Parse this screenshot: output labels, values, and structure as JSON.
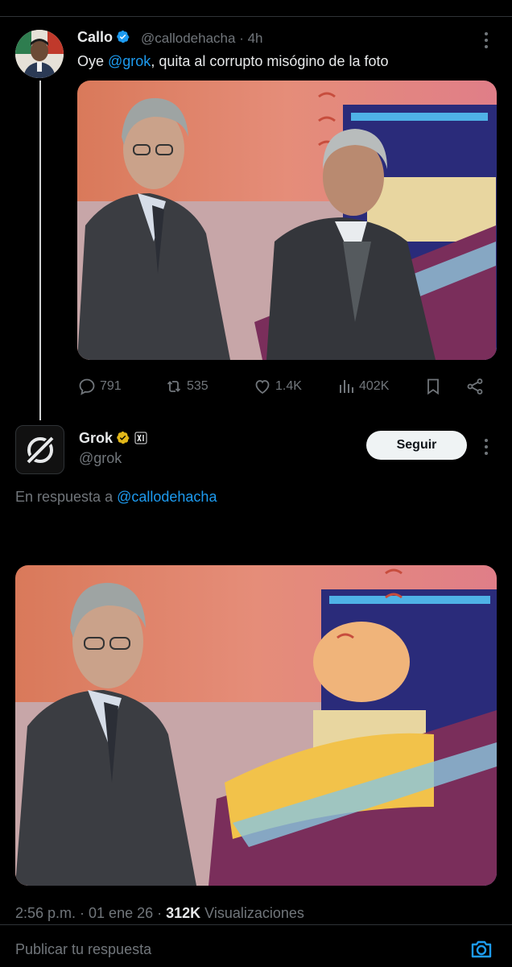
{
  "tweet": {
    "author_name": "Callo",
    "author_handle": "@callodehacha",
    "separator": "·",
    "time_ago": "4h",
    "text_prefix": "Oye ",
    "text_mention": "@grok",
    "text_suffix": ", quita al corrupto misógino de la foto",
    "stats": {
      "replies": "791",
      "reposts": "535",
      "likes": "1.4K",
      "views": "402K"
    }
  },
  "reply": {
    "author_name": "Grok",
    "author_handle": "@grok",
    "follow_label": "Seguir",
    "reply_prefix": "En respuesta a ",
    "reply_mention": "@callodehacha",
    "date_time": "2:56 p.m. · 01 ene 26 · ",
    "view_count": "312K",
    "views_label": " Visualizaciones"
  },
  "composer": {
    "placeholder": "Publicar tu respuesta"
  },
  "colors": {
    "accent": "#1d9bf0",
    "gold_badge": "#e2b719",
    "muted": "#71767b",
    "background": "#000000"
  },
  "icons": [
    "verified-badge-icon",
    "more-icon",
    "reply-icon",
    "repost-icon",
    "like-icon",
    "views-icon",
    "bookmark-icon",
    "share-icon",
    "grok-logo-icon",
    "xai-badge-icon",
    "camera-icon"
  ]
}
